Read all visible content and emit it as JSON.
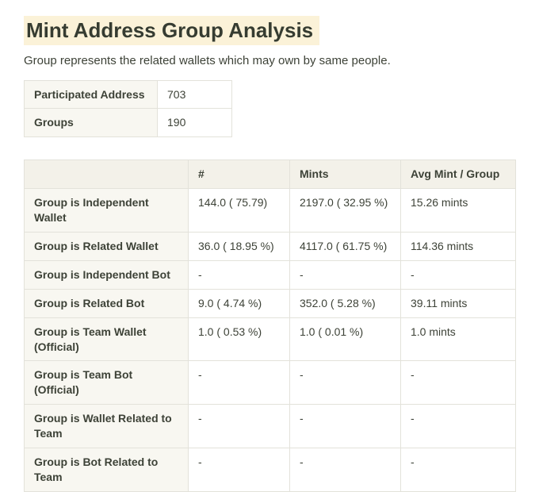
{
  "page": {
    "title": "Mint Address Group Analysis",
    "subtitle": "Group represents the related wallets which may own by same people."
  },
  "summary_table": {
    "rows": [
      {
        "label": "Participated Address",
        "value": "703"
      },
      {
        "label": "Groups",
        "value": "190"
      }
    ]
  },
  "analysis_table": {
    "headers": [
      "",
      "#",
      "Mints",
      "Avg Mint / Group"
    ],
    "rows": [
      {
        "label": "Group is Independent Wallet",
        "count": "144.0 ( 75.79)",
        "mints": "2197.0 ( 32.95 %)",
        "avg": "15.26 mints"
      },
      {
        "label": "Group is Related Wallet",
        "count": "36.0 ( 18.95 %)",
        "mints": "4117.0 ( 61.75 %)",
        "avg": "114.36 mints"
      },
      {
        "label": "Group is Independent Bot",
        "count": "-",
        "mints": "-",
        "avg": "-"
      },
      {
        "label": "Group is Related Bot",
        "count": "9.0 ( 4.74 %)",
        "mints": "352.0 ( 5.28 %)",
        "avg": "39.11 mints"
      },
      {
        "label": "Group is Team Wallet (Official)",
        "count": "1.0 ( 0.53 %)",
        "mints": "1.0 ( 0.01 %)",
        "avg": "1.0 mints"
      },
      {
        "label": "Group is Team Bot      (Official)",
        "count": "-",
        "mints": "-",
        "avg": "-"
      },
      {
        "label": "Group is Wallet Related to Team",
        "count": "-",
        "mints": "-",
        "avg": "-"
      },
      {
        "label": "Group is Bot Related to Team",
        "count": "-",
        "mints": "-",
        "avg": "-"
      }
    ]
  }
}
